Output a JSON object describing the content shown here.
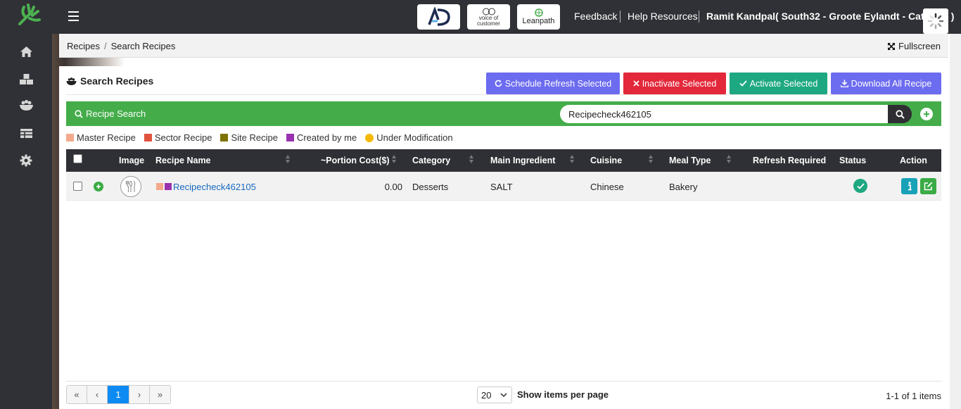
{
  "nav": {
    "items": [
      "home",
      "inventory",
      "recipes",
      "grid",
      "settings"
    ]
  },
  "topbar": {
    "partners": [
      "AD",
      "voice of customer",
      "Leanpath"
    ],
    "links": {
      "feedback": "Feedback",
      "help": "Help Resources",
      "user": "Ramit Kandpal( South32 - Groote Eylandt - Catering )"
    }
  },
  "breadcrumb": {
    "root": "Recipes",
    "current": "Search Recipes",
    "fullscreen": "Fullscreen"
  },
  "card": {
    "title": "Search Recipes",
    "buttons": {
      "schedule": "Schedule Refresh Selected",
      "inactivate": "Inactivate Selected",
      "activate": "Activate Selected",
      "download": "Download All Recipe"
    },
    "colors": {
      "schedule": "#6c6cf0",
      "inactivate": "#e3283b",
      "activate": "#1ea882",
      "download": "#6c6cf0",
      "search_bar": "#44ad4a"
    }
  },
  "search": {
    "label": "Recipe Search",
    "value": "Recipecheck462105"
  },
  "legend": [
    {
      "label": "Master Recipe",
      "color": "#f4a98d"
    },
    {
      "label": "Sector Recipe",
      "color": "#e2533e"
    },
    {
      "label": "Site Recipe",
      "color": "#7f7200"
    },
    {
      "label": "Created by me",
      "color": "#9a32b0"
    },
    {
      "label": "Under Modification",
      "color": "#f5b800"
    }
  ],
  "table": {
    "headers": {
      "image": "Image",
      "name": "Recipe Name",
      "cost": "~Portion Cost($)",
      "category": "Category",
      "ingredient": "Main Ingredient",
      "cuisine": "Cuisine",
      "meal": "Meal Type",
      "refresh": "Refresh Required",
      "status": "Status",
      "action": "Action"
    },
    "rows": [
      {
        "name": "Recipecheck462105",
        "cost": "0.00",
        "category": "Desserts",
        "ingredient": "SALT",
        "cuisine": "Chinese",
        "meal": "Bakery",
        "refresh": "",
        "status": "active"
      }
    ]
  },
  "pager": {
    "first": "«",
    "prev": "‹",
    "page": "1",
    "next": "›",
    "last": "»",
    "per_page": "20",
    "per_page_label": "Show items per page",
    "info": "1-1 of 1 items"
  }
}
